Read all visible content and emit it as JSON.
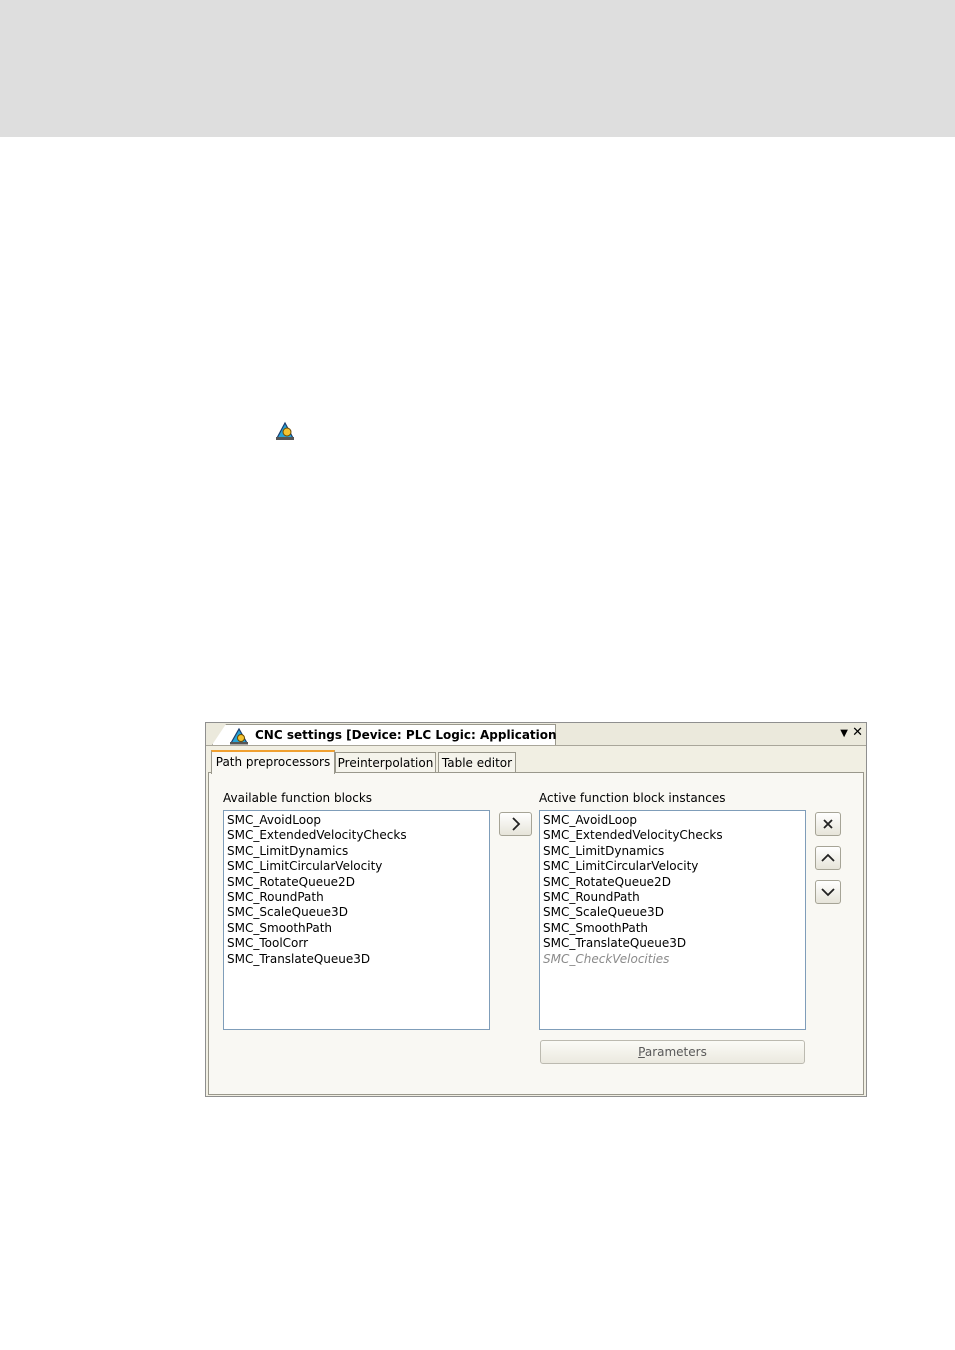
{
  "window": {
    "title": "CNC settings [Device: PLC Logic: Application]",
    "dropdown_glyph": "▼",
    "close_glyph": "✕"
  },
  "tabs": [
    {
      "label": "Path preprocessors",
      "active": true
    },
    {
      "label": "Preinterpolation",
      "active": false
    },
    {
      "label": "Table editor",
      "active": false
    }
  ],
  "available": {
    "label": "Available function blocks",
    "items": [
      "SMC_AvoidLoop",
      "SMC_ExtendedVelocityChecks",
      "SMC_LimitDynamics",
      "SMC_LimitCircularVelocity",
      "SMC_RotateQueue2D",
      "SMC_RoundPath",
      "SMC_ScaleQueue3D",
      "SMC_SmoothPath",
      "SMC_ToolCorr",
      "SMC_TranslateQueue3D"
    ]
  },
  "active": {
    "label": "Active function block instances",
    "items": [
      "SMC_AvoidLoop",
      "SMC_ExtendedVelocityChecks",
      "SMC_LimitDynamics",
      "SMC_LimitCircularVelocity",
      "SMC_RotateQueue2D",
      "SMC_RoundPath",
      "SMC_ScaleQueue3D",
      "SMC_SmoothPath",
      "SMC_TranslateQueue3D"
    ],
    "inactive_item": "SMC_CheckVelocities"
  },
  "buttons": {
    "add": "chevron-right-icon",
    "remove": "x-icon",
    "move_up": "chevron-up-icon",
    "move_down": "chevron-down-icon",
    "parameters_accel": "P",
    "parameters_rest": "arameters"
  },
  "colors": {
    "tab_accent": "#f0a030",
    "header_band": "#dedede",
    "listbox_border": "#7f9db9"
  }
}
